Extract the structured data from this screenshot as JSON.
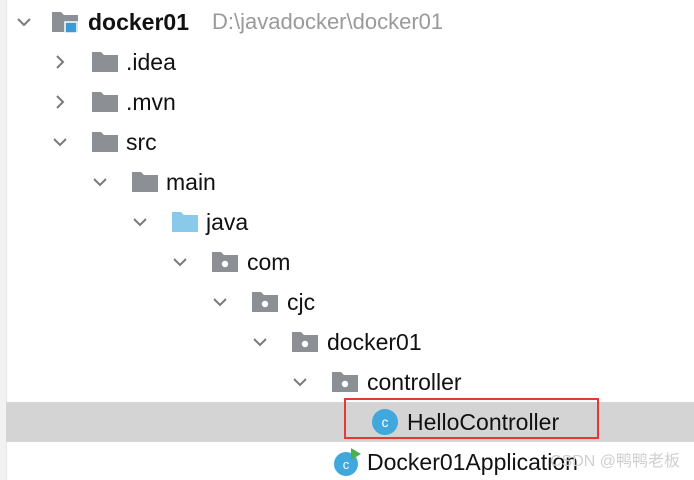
{
  "colors": {
    "folder_gray": "#8c8f94",
    "source_folder_blue": "#89c9ea",
    "class_icon_blue": "#40a8dc",
    "module_marker_blue": "#3b9bd6",
    "run_marker_green": "#4caf50",
    "selection_bg": "#d4d4d4",
    "highlight_red": "#e53935"
  },
  "tree": {
    "root": {
      "label": "docker01",
      "path": "D:\\javadocker\\docker01",
      "icon": "module-folder-icon",
      "expanded": true
    },
    "idea": {
      "label": ".idea",
      "icon": "folder-icon",
      "expanded": false
    },
    "mvn": {
      "label": ".mvn",
      "icon": "folder-icon",
      "expanded": false
    },
    "src": {
      "label": "src",
      "icon": "folder-icon",
      "expanded": true
    },
    "main": {
      "label": "main",
      "icon": "folder-icon",
      "expanded": true
    },
    "java": {
      "label": "java",
      "icon": "source-folder-icon",
      "expanded": true
    },
    "com": {
      "label": "com",
      "icon": "package-icon",
      "expanded": true
    },
    "cjc": {
      "label": "cjc",
      "icon": "package-icon",
      "expanded": true
    },
    "docker01pkg": {
      "label": "docker01",
      "icon": "package-icon",
      "expanded": true
    },
    "controller": {
      "label": "controller",
      "icon": "package-icon",
      "expanded": true
    },
    "hello": {
      "label": "HelloController",
      "icon": "class-icon",
      "selected": true
    },
    "app": {
      "label": "Docker01Application",
      "icon": "spring-boot-class-icon"
    }
  },
  "watermark": "CSDN @鸭鸭老板"
}
